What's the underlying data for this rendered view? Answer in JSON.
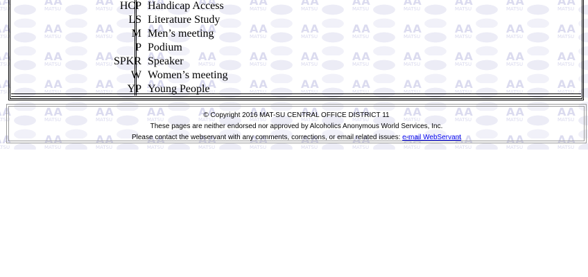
{
  "legend": {
    "rows": [
      {
        "code": "HCP",
        "desc": "Handicap Access"
      },
      {
        "code": "LS",
        "desc": "Literature Study"
      },
      {
        "code": "M",
        "desc": "Men’s meeting"
      },
      {
        "code": "P",
        "desc": "Podium"
      },
      {
        "code": "SPKR",
        "desc": "Speaker"
      },
      {
        "code": "W",
        "desc": "Women’s meeting"
      },
      {
        "code": "YP",
        "desc": "Young People"
      }
    ]
  },
  "footer": {
    "copyright": "© Copyright 2016 MAT-SU CENTRAL OFFICE DISTRICT 11",
    "disclaimer": "These pages are neither endorsed nor approved by Alcoholics Anonymous World Services, Inc.",
    "contact_text": "Please contact the webservant with any comments, corrections, or email related issues: ",
    "contact_link": "e-mail WebServant"
  },
  "watermark": {
    "big": "AA",
    "small": "MATSU"
  },
  "colors": {
    "link": "#0000ee",
    "watermark": "#bebee1"
  }
}
